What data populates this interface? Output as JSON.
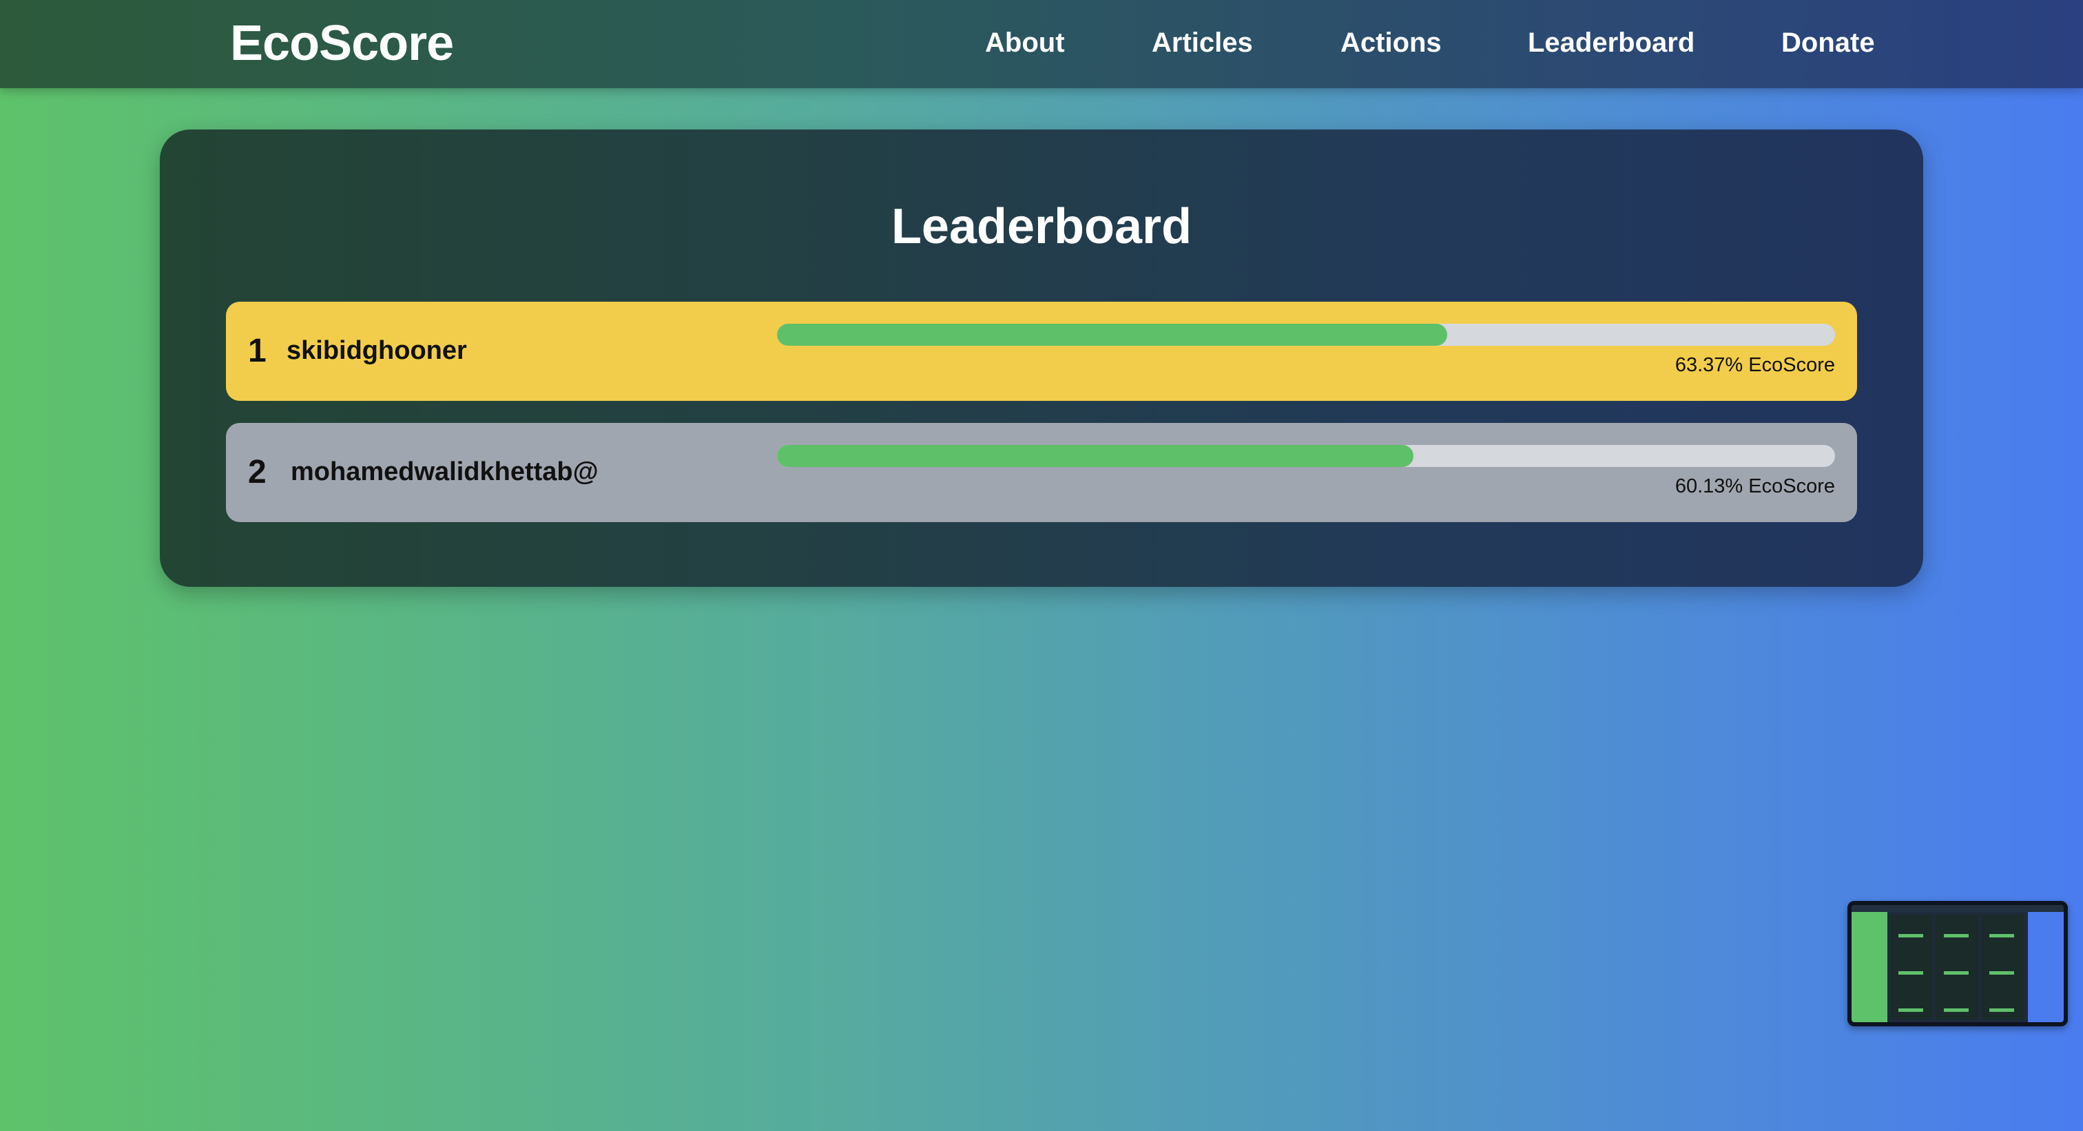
{
  "header": {
    "brand": "EcoScore",
    "nav": [
      "About",
      "Articles",
      "Actions",
      "Leaderboard",
      "Donate"
    ]
  },
  "leaderboard": {
    "title": "Leaderboard",
    "entries": [
      {
        "rank": "1",
        "name": "skibidghooner",
        "score_label": "63.37% EcoScore",
        "score": 63.37,
        "card_color": "#f2cd4b"
      },
      {
        "rank": "2",
        "name": "mohamedwalidkhettab@",
        "score_label": "60.13% EcoScore",
        "score": 60.13,
        "card_color": "#a0a6b0"
      }
    ]
  },
  "colors": {
    "progress_fill": "#5fc06a",
    "progress_track": "#d5d8dd",
    "gold": "#f2cd4b",
    "silver": "#a0a6b0"
  }
}
